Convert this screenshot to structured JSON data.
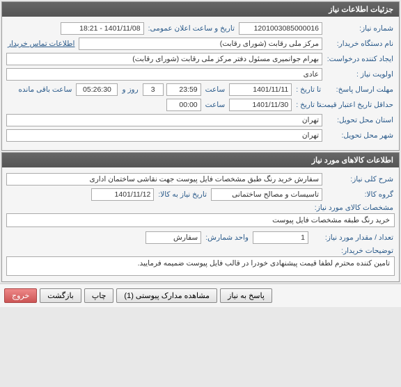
{
  "panel1": {
    "title": "جزئیات اطلاعات نیاز",
    "rows": {
      "request_no_label": "شماره نیاز:",
      "request_no": "1201003085000016",
      "public_announce_label": "تاریخ و ساعت اعلان عمومی:",
      "public_announce": "1401/11/08 - 18:21",
      "buyer_org_label": "نام دستگاه خریدار:",
      "buyer_org": "مرکز ملی رقابت (شورای رقابت)",
      "buyer_contact_link": "اطلاعات تماس خریدار",
      "requester_label": "ایجاد کننده درخواست:",
      "requester": "بهرام جوانمیری مسئول دفتر مرکز ملی رقابت (شورای رقابت)",
      "priority_label": "اولویت نیاز :",
      "priority": "عادی",
      "reply_deadline_label": "مهلت ارسال پاسخ:",
      "to_date_label": "تا تاریخ :",
      "reply_date": "1401/11/11",
      "time_label": "ساعت",
      "reply_time": "23:59",
      "days_remaining": "3",
      "days_and_label": "روز و",
      "countdown": "05:26:30",
      "remaining_label": "ساعت باقی مانده",
      "price_valid_label": "حداقل تاریخ اعتبار قیمت:",
      "price_valid_date": "1401/11/30",
      "price_valid_time": "00:00",
      "delivery_prov_label": "استان محل تحویل:",
      "delivery_prov": "تهران",
      "delivery_city_label": "شهر محل تحویل:",
      "delivery_city": "تهران"
    }
  },
  "panel2": {
    "title": "اطلاعات کالاهای مورد نیاز",
    "desc_label": "شرح کلی نیاز:",
    "desc": "سفارش خرید رنگ طبق مشخصات فایل پیوست جهت نقاشی ساختمان اداری",
    "group_label": "گروه کالا:",
    "group": "تاسیسات و مصالح ساختمانی",
    "need_date_label": "تاریخ نیاز به کالا:",
    "need_date": "1401/11/12",
    "item_spec_label": "مشخصات کالای مورد نیاز:",
    "item_spec": "خرید رنگ طبقه مشخصات فایل پیوست",
    "qty_label": "تعداد / مقدار مورد نیاز:",
    "qty": "1",
    "unit_label": "واحد شمارش:",
    "unit": "سفارش",
    "buyer_notes_label": "توضیحات خریدار:",
    "buyer_notes": "تامین کننده محترم لطفا قیمت پیشنهادی خودرا در قالب فایل پیوست ضمیمه فرمایید."
  },
  "buttons": {
    "respond": "پاسخ به نیاز",
    "attachments": "مشاهده مدارک پیوستی (1)",
    "print": "چاپ",
    "back": "بازگشت",
    "exit": "خروج"
  }
}
